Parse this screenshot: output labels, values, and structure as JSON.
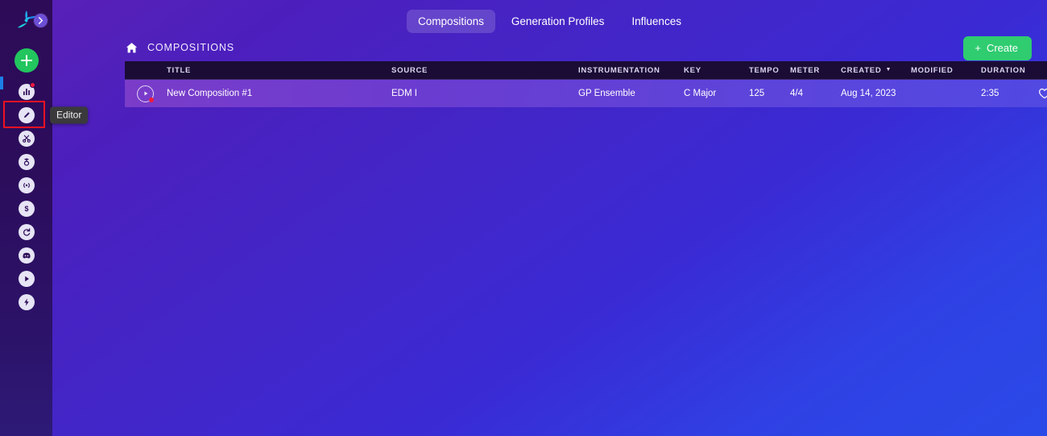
{
  "app": {
    "logo_icon": "propeller-logo-icon",
    "collapse_icon": "chevron-right-icon",
    "accent_green": "#22c55e",
    "accent_red": "#ee1122",
    "brand_blue": "#1d7fe8",
    "background_gradient": [
      "#5b21b6",
      "#2a4ae8"
    ]
  },
  "sidebar": {
    "add_button_label": "+",
    "add_button_icon": "plus-icon",
    "items": [
      {
        "icon": "bar-chart-icon",
        "label": "Dashboard",
        "badge": true,
        "highlighted": false
      },
      {
        "icon": "pencil-icon",
        "label": "Editor",
        "badge": false,
        "highlighted": true
      },
      {
        "icon": "scissors-icon",
        "label": "Clip Editor",
        "badge": false,
        "highlighted": false
      },
      {
        "icon": "microphone-icon",
        "label": "Voice",
        "badge": false,
        "highlighted": false
      },
      {
        "icon": "broadcast-icon",
        "label": "Live",
        "badge": false,
        "highlighted": false
      },
      {
        "icon": "dollar-icon",
        "label": "Pricing",
        "badge": false,
        "highlighted": false
      },
      {
        "icon": "history-icon",
        "label": "History",
        "badge": false,
        "highlighted": false
      },
      {
        "icon": "discord-icon",
        "label": "Discord",
        "badge": false,
        "highlighted": false
      },
      {
        "icon": "play-icon",
        "label": "Tutorials",
        "badge": false,
        "highlighted": false
      },
      {
        "icon": "lightning-icon",
        "label": "Upgrade",
        "badge": false,
        "highlighted": false
      }
    ],
    "tooltip": {
      "visible": true,
      "text": "Editor"
    }
  },
  "top_tabs": {
    "active": "Compositions",
    "items": [
      {
        "label": "Compositions",
        "active": true
      },
      {
        "label": "Generation Profiles",
        "active": false
      },
      {
        "label": "Influences",
        "active": false
      }
    ]
  },
  "page_header": {
    "home_icon": "home-icon",
    "breadcrumb": "COMPOSITIONS",
    "create_button": {
      "label": "Create",
      "plus": "+",
      "color": "#2fcc70"
    }
  },
  "table": {
    "columns": [
      {
        "key": "title",
        "label": "TITLE"
      },
      {
        "key": "source",
        "label": "SOURCE"
      },
      {
        "key": "instrumentation",
        "label": "INSTRUMENTATION"
      },
      {
        "key": "key",
        "label": "KEY"
      },
      {
        "key": "tempo",
        "label": "TEMPO"
      },
      {
        "key": "meter",
        "label": "METER"
      },
      {
        "key": "created",
        "label": "CREATED"
      },
      {
        "key": "modified",
        "label": "MODIFIED"
      },
      {
        "key": "duration",
        "label": "DURATION"
      }
    ],
    "sort": {
      "column": "CREATED",
      "direction": "desc",
      "caret": "▼"
    },
    "rows": [
      {
        "play_icon": "play-circle-icon",
        "has_notification_dot": true,
        "title": "New Composition #1",
        "source": "EDM I",
        "instrumentation": "GP Ensemble",
        "key": "C Major",
        "tempo": "125",
        "meter": "4/4",
        "created": "Aug 14, 2023",
        "modified": "",
        "duration": "2:35",
        "favorite_icon": "heart-outline-icon",
        "favorited": false,
        "selected": true
      }
    ]
  }
}
